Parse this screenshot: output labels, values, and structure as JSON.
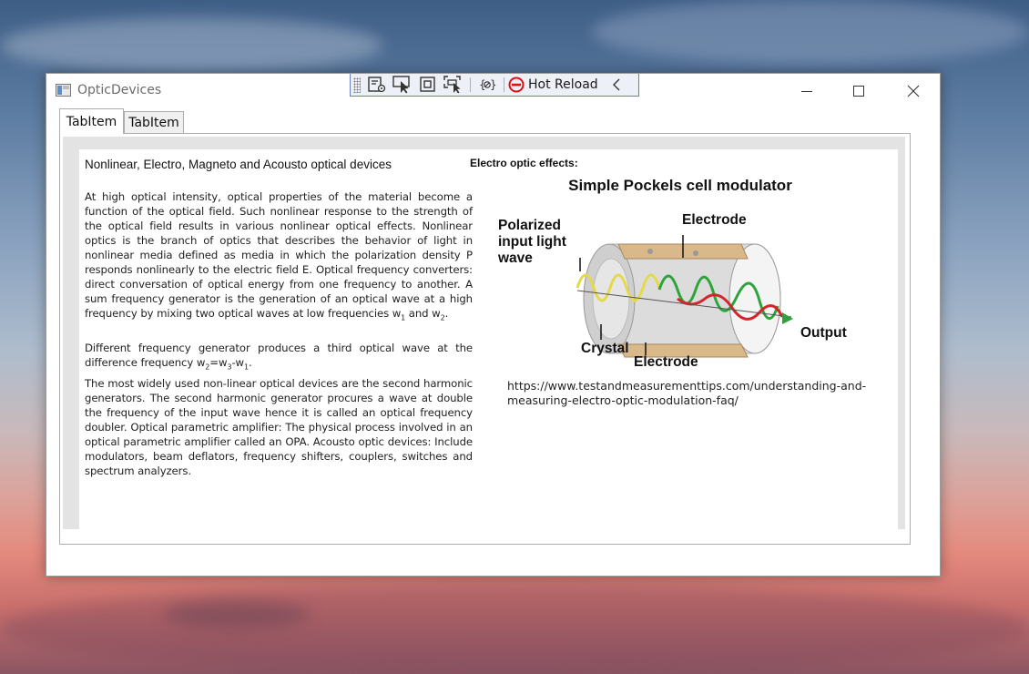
{
  "window": {
    "title": "OpticDevices",
    "controls": {
      "minimize": "minimize",
      "maximize": "maximize",
      "close": "close"
    }
  },
  "devtools": {
    "hot_reload_label": "Hot Reload",
    "icons": [
      "visual-tree-icon",
      "select-element-icon",
      "display-layout-adorners-icon",
      "track-focus-icon",
      "binding-failures-icon",
      "hot-reload-icon",
      "collapse-chevron-icon"
    ]
  },
  "tabs": [
    {
      "label": "TabItem",
      "selected": true
    },
    {
      "label": "TabItem",
      "selected": false
    }
  ],
  "main": {
    "heading": "Nonlinear, Electro, Magneto and Acousto optical devices",
    "para1": "At high optical intensity, optical properties of the material become a function of the optical field. Such nonlinear response to the strength of the optical field results in various nonlinear optical effects. Nonlinear optics is the branch of optics that describes the behavior of light in nonlinear media defined as media in which the polarization density P responds nonlinearly to the electric field E. Optical frequency converters: direct conversation of optical energy from one frequency to another.  A sum frequency generator is the generation of an optical wave at a high frequency by mixing two optical waves at low frequencies",
    "para1_w1": "w",
    "para1_w1_sub": "1",
    "para1_and": " and ",
    "para1_w2": "w",
    "para1_w2_sub": "2",
    "para1_end": ".",
    "para2_text": "Different frequency generator produces a third optical wave at the difference frequency ",
    "para2_formula_w2": "w",
    "para2_formula_w2_sub": "2",
    "para2_formula_eq": "=w",
    "para2_formula_w3_sub": "3",
    "para2_formula_minus": "-w",
    "para2_formula_w1_sub": "1",
    "para2_end": ".",
    "para3": "The most widely used non-linear optical devices are the second harmonic generators.  The second harmonic generator procures a wave at double the frequency of the input wave hence it is called an optical frequency doubler. Optical parametric amplifier: The physical process involved in an optical parametric amplifier called an OPA. Acousto optic devices: Include modulators, beam deflators, frequency shifters, couplers, switches and spectrum analyzers.",
    "eo_label": "Electro optic effects:",
    "figure": {
      "title": "Simple Pockels cell modulator",
      "label_polarized_1": "Polarized",
      "label_polarized_2": "input light",
      "label_polarized_3": "wave",
      "label_electrode_top": "Electrode",
      "label_crystal": "Crystal",
      "label_electrode_bottom": "Electrode",
      "label_output": "Output"
    },
    "url": "https://www.testandmeasurementtips.com/understanding-and-measuring-electro-optic-modulation-faq/"
  }
}
